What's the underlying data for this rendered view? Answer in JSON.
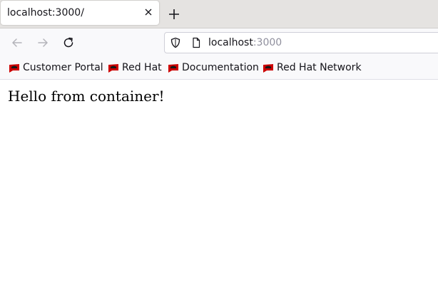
{
  "tab": {
    "title": "localhost:3000/"
  },
  "urlbar": {
    "host": "localhost",
    "port": ":3000"
  },
  "bookmarks": [
    {
      "label": "Customer Portal",
      "icon": "redhat-icon"
    },
    {
      "label": "Red Hat",
      "icon": "redhat-icon"
    },
    {
      "label": "Documentation",
      "icon": "redhat-icon"
    },
    {
      "label": "Red Hat Network",
      "icon": "redhat-icon"
    }
  ],
  "page": {
    "text": "Hello from container!"
  },
  "colors": {
    "tabbar": "#e5e3e1",
    "toolbar": "#f9f9fb",
    "redhat": "#cc0000"
  }
}
